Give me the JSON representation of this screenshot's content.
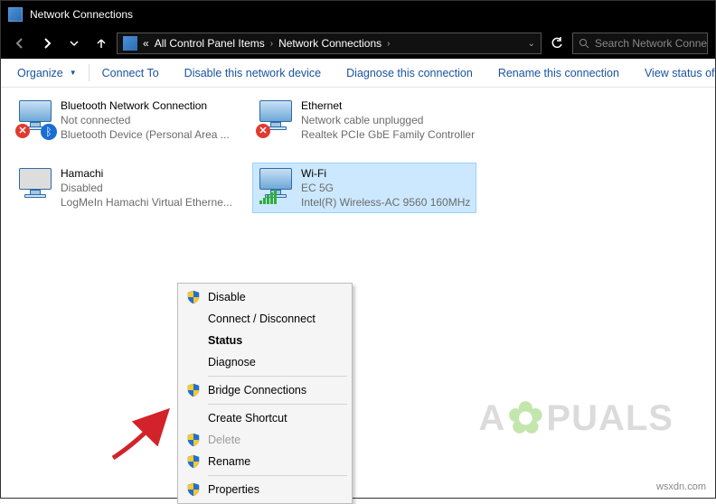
{
  "window": {
    "title": "Network Connections"
  },
  "breadcrumb": {
    "prefix": "«",
    "items": [
      "All Control Panel Items",
      "Network Connections"
    ]
  },
  "search": {
    "placeholder": "Search Network Connec"
  },
  "commands": {
    "organize": "Organize",
    "connect_to": "Connect To",
    "disable": "Disable this network device",
    "diagnose": "Diagnose this connection",
    "rename": "Rename this connection",
    "view_status": "View status of t"
  },
  "adapters": [
    {
      "name": "Bluetooth Network Connection",
      "status": "Not connected",
      "device": "Bluetooth Device (Personal Area ..."
    },
    {
      "name": "Ethernet",
      "status": "Network cable unplugged",
      "device": "Realtek PCIe GbE Family Controller"
    },
    {
      "name": "Hamachi",
      "status": "Disabled",
      "device": "LogMeIn Hamachi Virtual Etherne..."
    },
    {
      "name": "Wi-Fi",
      "status": "EC 5G",
      "device": "Intel(R) Wireless-AC 9560 160MHz"
    }
  ],
  "context_menu": {
    "disable": "Disable",
    "connect_disconnect": "Connect / Disconnect",
    "status": "Status",
    "diagnose": "Diagnose",
    "bridge": "Bridge Connections",
    "shortcut": "Create Shortcut",
    "delete": "Delete",
    "rename": "Rename",
    "properties": "Properties"
  },
  "watermark": {
    "brand_left": "A",
    "brand_right": "PUALS",
    "url": "wsxdn.com"
  }
}
